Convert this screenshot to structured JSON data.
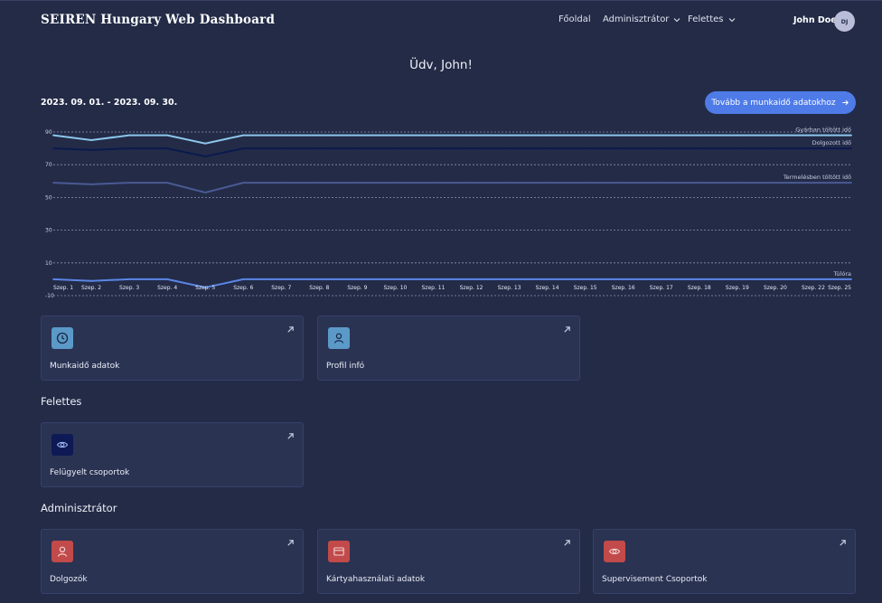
{
  "header": {
    "brand": "SEIREN Hungary Web Dashboard",
    "nav": [
      {
        "label": "Főoldal",
        "dropdown": false
      },
      {
        "label": "Adminisztrátor",
        "dropdown": true
      },
      {
        "label": "Felettes",
        "dropdown": true
      }
    ],
    "user_name": "John Doe",
    "user_initials": "DJ"
  },
  "welcome": "Üdv, John!",
  "date_range": "2023. 09. 01. - 2023. 09. 30.",
  "cta_label": "Tovább a munkaidő adatokhoz",
  "chart_data": {
    "type": "line",
    "x": [
      "Szep. 1",
      "Szep. 2",
      "Szep. 3",
      "Szep. 4",
      "Szep. 5",
      "Szep. 6",
      "Szep. 7",
      "Szep. 8",
      "Szep. 9",
      "Szep. 10",
      "Szep. 11",
      "Szep. 12",
      "Szep. 13",
      "Szep. 14",
      "Szep. 15",
      "Szep. 16",
      "Szep. 17",
      "Szep. 18",
      "Szep. 19",
      "Szep. 20",
      "Szep. 22",
      "Szep. 25"
    ],
    "yticks": [
      90,
      70,
      50,
      30,
      10,
      -10
    ],
    "ylim": [
      -10,
      90
    ],
    "grid": true,
    "series": [
      {
        "name": "Gyárban töltött idő",
        "color": "#8cc6ec",
        "values": [
          88,
          85,
          88,
          88,
          83,
          88,
          88,
          88,
          88,
          88,
          88,
          88,
          88,
          88,
          88,
          88,
          88,
          88,
          88,
          88,
          88,
          88
        ]
      },
      {
        "name": "Dolgozott idő",
        "color": "#0b1a4e",
        "values": [
          80,
          79,
          80,
          80,
          75,
          80,
          80,
          80,
          80,
          80,
          80,
          80,
          80,
          80,
          80,
          80,
          80,
          80,
          80,
          80,
          80,
          80
        ]
      },
      {
        "name": "Termelésben töltött idő",
        "color": "#4a5a94",
        "values": [
          59,
          58,
          59,
          59,
          53,
          59,
          59,
          59,
          59,
          59,
          59,
          59,
          59,
          59,
          59,
          59,
          59,
          59,
          59,
          59,
          59,
          59
        ]
      },
      {
        "name": "Túlóra",
        "color": "#5b86e6",
        "values": [
          0,
          -1,
          0,
          0,
          -5,
          0,
          0,
          0,
          0,
          0,
          0,
          0,
          0,
          0,
          0,
          0,
          0,
          0,
          0,
          0,
          0,
          0
        ]
      }
    ]
  },
  "cards_top": [
    {
      "label": "Munkaidő adatok",
      "icon": "clock-icon",
      "icon_bg": "#5b9ac8"
    },
    {
      "label": "Profil infó",
      "icon": "user-icon",
      "icon_bg": "#5b9ac8"
    }
  ],
  "section_supervisor": "Felettes",
  "cards_supervisor": [
    {
      "label": "Felügyelt csoportok",
      "icon": "eye-icon",
      "icon_bg": "#0d1a55"
    }
  ],
  "section_admin": "Adminisztrátor",
  "cards_admin": [
    {
      "label": "Dolgozók",
      "icon": "user-icon",
      "icon_bg": "#c24a4a"
    },
    {
      "label": "Kártyahasználati adatok",
      "icon": "card-icon",
      "icon_bg": "#c24a4a"
    },
    {
      "label": "Supervisement Csoportok",
      "icon": "eye-icon",
      "icon_bg": "#c24a4a"
    }
  ]
}
